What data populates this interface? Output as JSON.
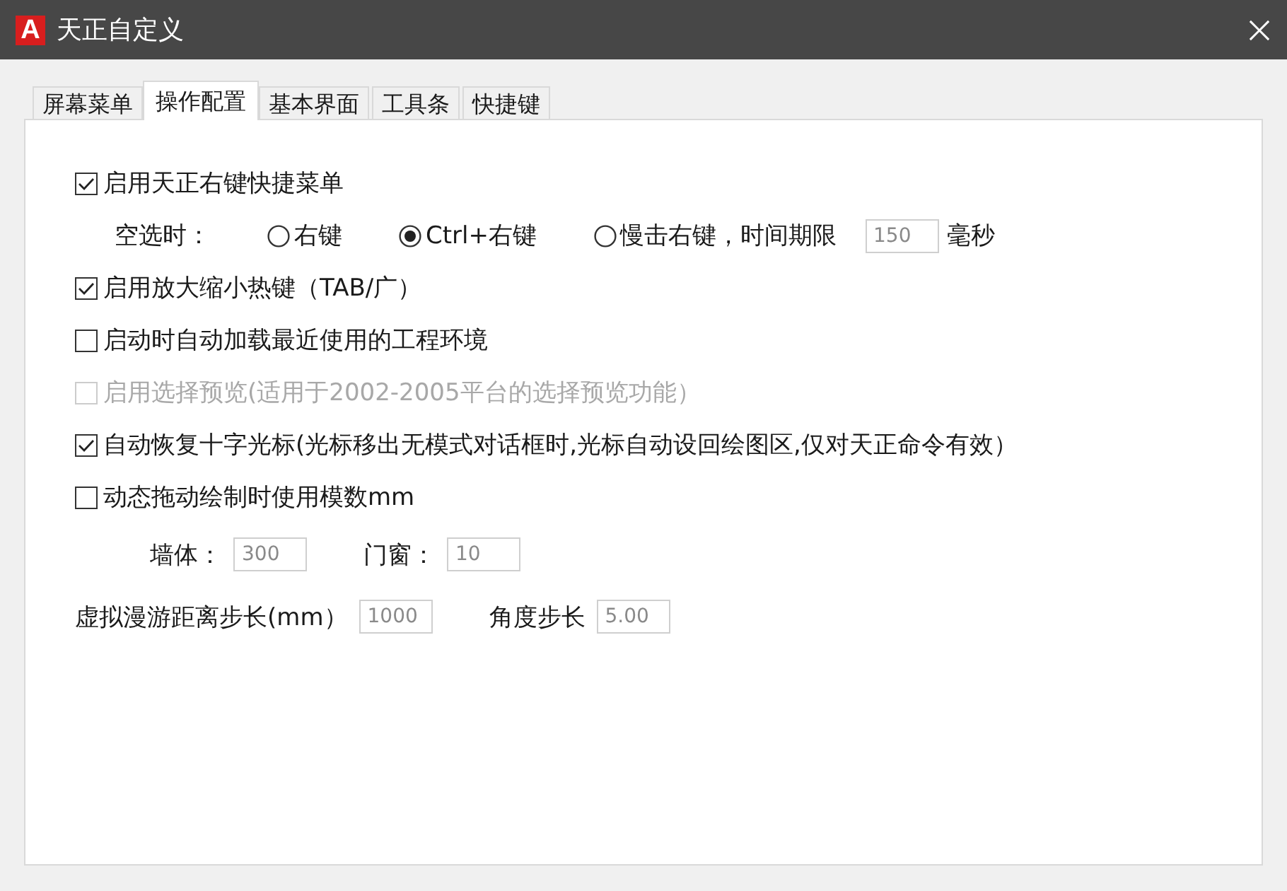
{
  "window": {
    "logo": "A",
    "title": "天正自定义"
  },
  "tabs": [
    {
      "label": "屏幕菜单",
      "selected": false
    },
    {
      "label": "操作配置",
      "selected": true
    },
    {
      "label": "基本界面",
      "selected": false
    },
    {
      "label": "工具条",
      "selected": false
    },
    {
      "label": "快捷键",
      "selected": false
    }
  ],
  "settings": [
    {
      "kind": "checkbox",
      "label": "启用天正右键快捷菜单",
      "checked": true,
      "disabled": false,
      "children": [
        {
          "kind": "radio_group",
          "label": "空选时：",
          "options": [
            {
              "label": "右键",
              "selected": false
            },
            {
              "label": "Ctrl+右键",
              "selected": true
            },
            {
              "label": "慢击右键，时间期限",
              "selected": false,
              "field": {
                "value": "150"
              },
              "unit": "毫秒"
            }
          ]
        }
      ]
    },
    {
      "kind": "checkbox",
      "label": "启用放大缩小热键（TAB/广）",
      "checked": true,
      "disabled": false
    },
    {
      "kind": "checkbox",
      "label": "启动时自动加载最近使用的工程环境",
      "checked": false,
      "disabled": false
    },
    {
      "kind": "checkbox",
      "label": "启用选择预览(适用于2002-2005平台的选择预览功能）",
      "checked": false,
      "disabled": true
    },
    {
      "kind": "checkbox",
      "label": "自动恢复十字光标(光标移出无模式对话框时,光标自动设回绘图区,仅对天正命令有效）",
      "checked": true,
      "disabled": false
    },
    {
      "kind": "checkbox",
      "label": "动态拖动绘制时使用模数mm",
      "checked": false,
      "disabled": false,
      "children": [
        {
          "kind": "fields",
          "fields": [
            {
              "label": "墙体：",
              "value": "300"
            },
            {
              "label": "门窗：",
              "value": "10"
            }
          ]
        }
      ]
    },
    {
      "kind": "fields",
      "fields": [
        {
          "label": "虚拟漫游距离步长(mm）",
          "value": "1000"
        },
        {
          "label": "角度步长",
          "value": "5.00"
        }
      ]
    }
  ]
}
